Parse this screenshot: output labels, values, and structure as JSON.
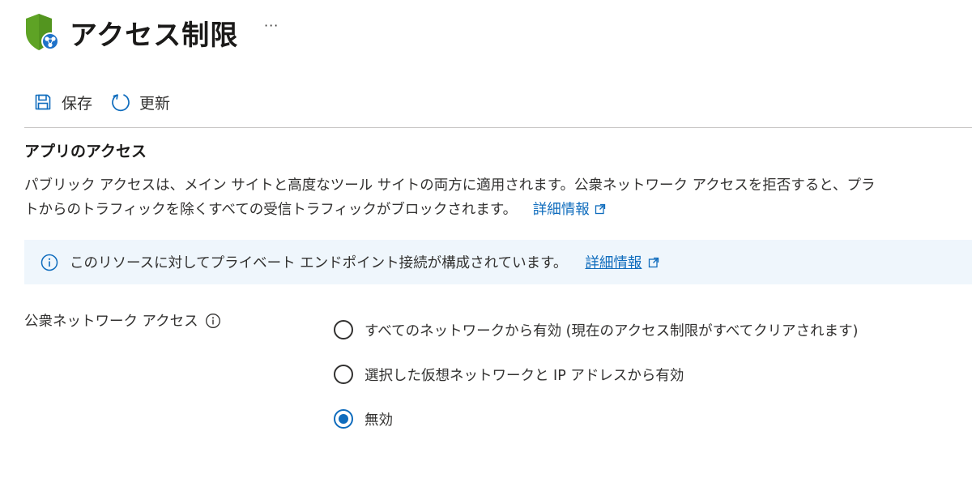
{
  "header": {
    "title": "アクセス制限",
    "more_label": "···",
    "icon": "shield-network-icon",
    "shield_color": "#5ea325",
    "globe_color": "#1f72c9"
  },
  "toolbar": {
    "save_label": "保存",
    "refresh_label": "更新",
    "save_icon": "save-icon",
    "refresh_icon": "refresh-icon"
  },
  "app_access": {
    "title": "アプリのアクセス",
    "description_line1": "パブリック アクセスは、メイン サイトと高度なツール サイトの両方に適用されます。公衆ネットワーク アクセスを拒否すると、プラ",
    "description_line2": "トからのトラフィックを除くすべての受信トラフィックがブロックされます。",
    "learn_more": "詳細情報"
  },
  "banner": {
    "text": "このリソースに対してプライベート エンドポイント接続が構成されています。",
    "learn_more": "詳細情報",
    "background": "#eff6fc",
    "icon": "info-icon"
  },
  "network_access": {
    "label": "公衆ネットワーク アクセス",
    "options": [
      {
        "label": "すべてのネットワークから有効 (現在のアクセス制限がすべてクリアされます)",
        "selected": false
      },
      {
        "label": "選択した仮想ネットワークと IP アドレスから有効",
        "selected": false
      },
      {
        "label": "無効",
        "selected": true
      }
    ]
  },
  "colors": {
    "accent": "#0f6cbd",
    "text": "#323130"
  }
}
